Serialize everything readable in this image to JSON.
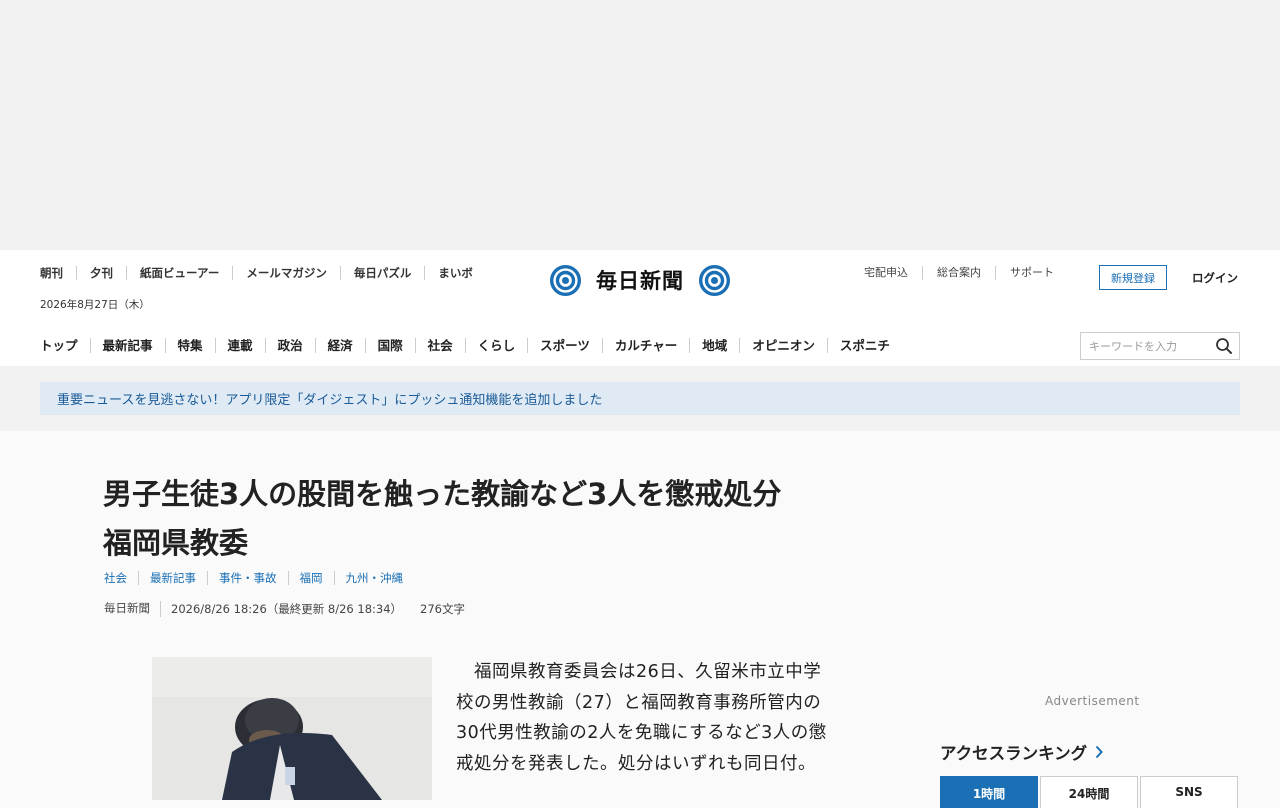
{
  "header": {
    "top_nav": [
      "朝刊",
      "夕刊",
      "紙面ビューアー",
      "メールマガジン",
      "毎日パズル",
      "まいボ"
    ],
    "date": "2026年8月27日（木）",
    "logo_text": "毎日新聞",
    "util_nav": [
      "宅配申込",
      "総合案内",
      "サポート"
    ],
    "register_label": "新規登録",
    "login_label": "ログイン",
    "main_nav": [
      "トップ",
      "最新記事",
      "特集",
      "連載",
      "政治",
      "経済",
      "国際",
      "社会",
      "くらし",
      "スポーツ",
      "カルチャー",
      "地域",
      "オピニオン",
      "スポニチ"
    ],
    "search": {
      "placeholder": "キーワードを入力"
    }
  },
  "banner": {
    "text": "重要ニュースを見逃さない！アプリ限定「ダイジェスト」にプッシュ通知機能を追加しました"
  },
  "article": {
    "title_lines": [
      "男子生徒3人の股間を触った教諭など3人を懲戒処分",
      "福岡県教委"
    ],
    "tags": [
      "社会",
      "最新記事",
      "事件・事故",
      "福岡",
      "九州・沖縄"
    ],
    "source": "毎日新聞",
    "timestamp": "2026/8/26 18:26（最終更新 8/26 18:34）",
    "char_count": "276文字",
    "body": "　福岡県教育委員会は26日、久留米市立中学校の男性教諭（27）と福岡教育事務所管内の30代男性教諭の2人を免職にするなど3人の懲戒処分を発表した。処分はいずれも同日付。"
  },
  "sidebar": {
    "ad_label": "Advertisement",
    "ranking_title": "アクセスランキング",
    "ranking_tabs": [
      "1時間",
      "24時間",
      "SNS"
    ],
    "active_tab": 0
  },
  "colors": {
    "brand": "#1a6fb5",
    "banner_bg": "#dfeaf4",
    "banner_text": "#1a5a96"
  }
}
